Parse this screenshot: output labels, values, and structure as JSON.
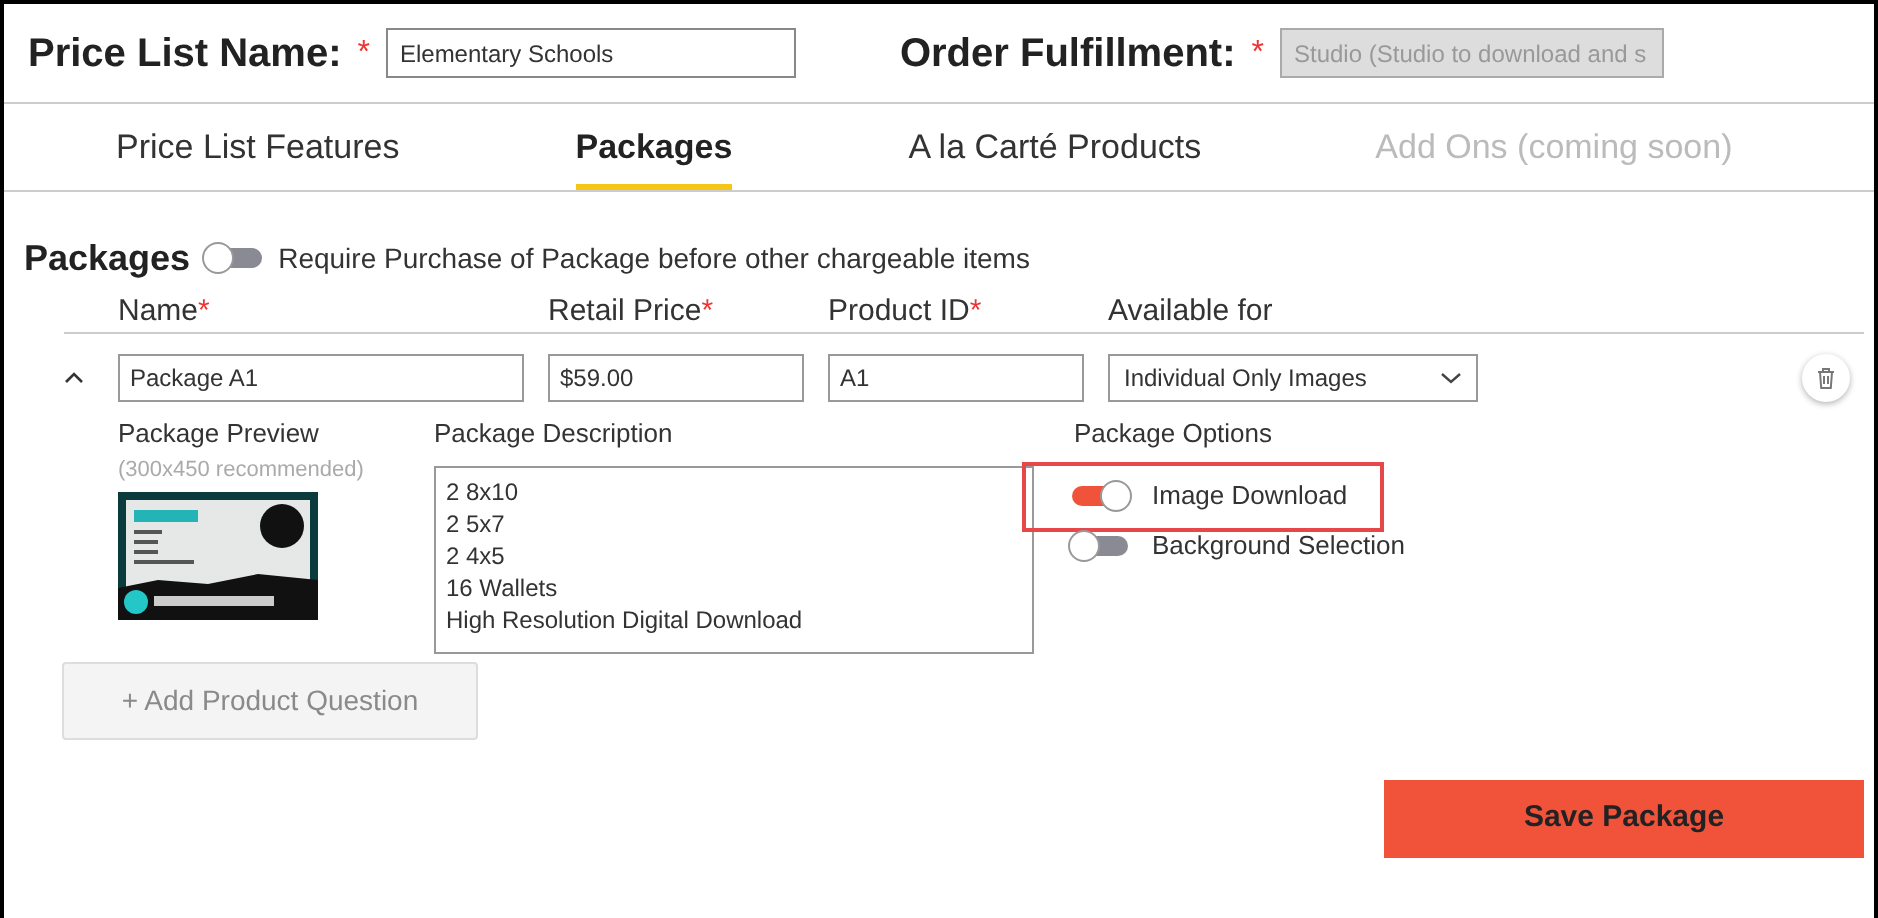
{
  "header": [
    {
      "label": "Price List Name:",
      "required_mark": "*",
      "value": "Elementary Schools",
      "disabled": false
    },
    {
      "label": "Order Fulfillment:",
      "required_mark": "*",
      "value": "Studio (Studio to download and s",
      "disabled": true
    }
  ],
  "tabs": [
    {
      "label": "Price List Features",
      "selected": false,
      "disabled": false
    },
    {
      "label": "Packages",
      "selected": true,
      "disabled": false
    },
    {
      "label": "A la Carté Products",
      "selected": false,
      "disabled": false
    },
    {
      "label": "Add Ons (coming soon)",
      "selected": false,
      "disabled": true
    }
  ],
  "section": {
    "title": "Packages",
    "toggle": {
      "label": "Require Purchase of Package before other chargeable items",
      "on": false
    }
  },
  "columns": [
    {
      "label": "Name",
      "required_mark": "*"
    },
    {
      "label": "Retail Price",
      "required_mark": "*"
    },
    {
      "label": "Product ID",
      "required_mark": "*"
    },
    {
      "label": "Available for"
    }
  ],
  "package": {
    "expanded": true,
    "name": "Package A1",
    "price": "$59.00",
    "product_id": "A1",
    "available_for": "Individual Only Images",
    "preview": {
      "label": "Package Preview",
      "hint": "(300x450 recommended)"
    },
    "description": {
      "label": "Package Description",
      "lines": [
        "2 8x10",
        "2 5x7",
        "2 4x5",
        "16 Wallets",
        "High Resolution Digital Download"
      ]
    },
    "options": {
      "label": "Package Options",
      "items": [
        {
          "label": "Image Download",
          "on": true,
          "highlighted": true
        },
        {
          "label": "Background Selection",
          "on": false,
          "highlighted": false
        }
      ]
    }
  },
  "add_question": {
    "label": "+ Add Product Question",
    "disabled": true
  },
  "save": {
    "label": "Save Package"
  }
}
